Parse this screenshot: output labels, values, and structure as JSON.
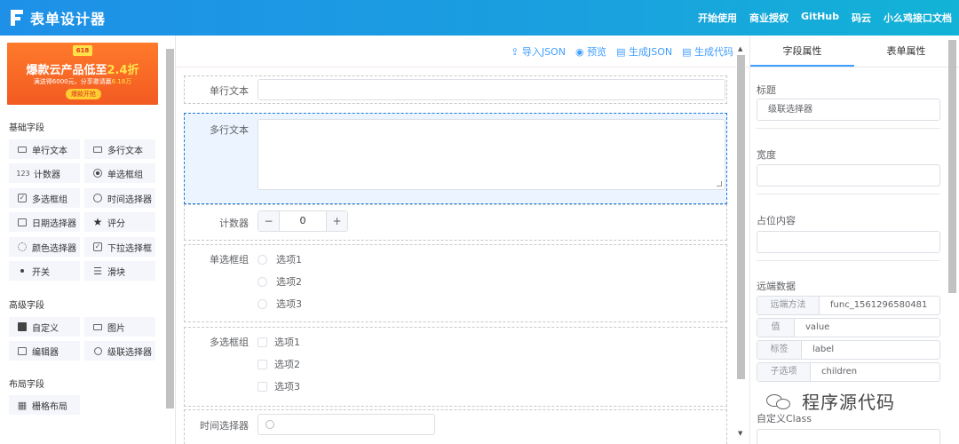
{
  "header": {
    "title": "表单设计器",
    "nav": [
      "开始使用",
      "商业授权",
      "GitHub",
      "码云",
      "小么鸡接口文档"
    ]
  },
  "banner": {
    "tag": "618",
    "title_prefix": "爆款云产品低至",
    "title_highlight": "2.4折",
    "sub_prefix": "满送得6000元，分享邀请赢",
    "sub_highlight": "6.18万",
    "button": "爆款开抢"
  },
  "left": {
    "basic_title": "基础字段",
    "advanced_title": "高级字段",
    "layout_title": "布局字段",
    "basic": [
      {
        "label": "单行文本",
        "icon": "input-icon"
      },
      {
        "label": "多行文本",
        "icon": "textarea-icon"
      },
      {
        "label": "计数器",
        "icon": "number-icon",
        "glyph": "123"
      },
      {
        "label": "单选框组",
        "icon": "radio-icon"
      },
      {
        "label": "多选框组",
        "icon": "checkbox-icon"
      },
      {
        "label": "时间选择器",
        "icon": "clock-icon"
      },
      {
        "label": "日期选择器",
        "icon": "calendar-icon"
      },
      {
        "label": "评分",
        "icon": "star-icon"
      },
      {
        "label": "颜色选择器",
        "icon": "palette-icon"
      },
      {
        "label": "下拉选择框",
        "icon": "select-icon"
      },
      {
        "label": "开关",
        "icon": "switch-icon"
      },
      {
        "label": "滑块",
        "icon": "slider-icon"
      }
    ],
    "advanced": [
      {
        "label": "自定义",
        "icon": "custom-icon"
      },
      {
        "label": "图片",
        "icon": "image-icon"
      },
      {
        "label": "编辑器",
        "icon": "editor-icon"
      },
      {
        "label": "级联选择器",
        "icon": "cascader-icon"
      }
    ],
    "layout": [
      {
        "label": "栅格布局",
        "icon": "grid-icon"
      }
    ]
  },
  "toolbar": {
    "import_json": "导入JSON",
    "preview": "预览",
    "generate_json": "生成JSON",
    "generate_code": "生成代码"
  },
  "form": {
    "text_label": "单行文本",
    "textarea_label": "多行文本",
    "number_label": "计数器",
    "number_value": "0",
    "number_minus": "−",
    "number_plus": "+",
    "radio_label": "单选框组",
    "radio_options": [
      "选项1",
      "选项2",
      "选项3"
    ],
    "checkbox_label": "多选框组",
    "checkbox_options": [
      "选项1",
      "选项2",
      "选项3"
    ],
    "time_label": "时间选择器"
  },
  "right": {
    "tabs": [
      "字段属性",
      "表单属性"
    ],
    "active_tab": 0,
    "title_label": "标题",
    "title_value": "级联选择器",
    "width_label": "宽度",
    "width_value": "",
    "placeholder_label": "占位内容",
    "placeholder_value": "",
    "remote_label": "远端数据",
    "remote_rows": [
      {
        "prefix": "远端方法",
        "value": "func_1561296580481"
      },
      {
        "prefix": "值",
        "value": "value"
      },
      {
        "prefix": "标签",
        "value": "label"
      },
      {
        "prefix": "子选项",
        "value": "children"
      }
    ],
    "custom_class_label": "自定义Class"
  },
  "watermark": "程序源代码",
  "colors": {
    "header_start": "#1e90e8",
    "header_end": "#12b3d6",
    "accent": "#409eff",
    "active_field_bg": "#ecf5ff",
    "active_field_border": "#1f7bdf"
  }
}
